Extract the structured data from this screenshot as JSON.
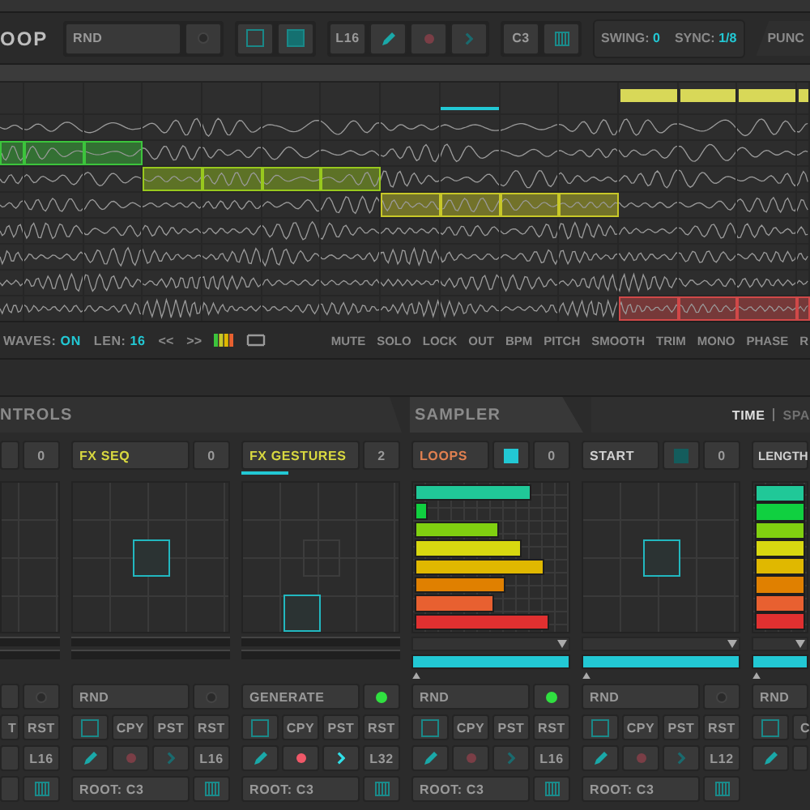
{
  "toolbar": {
    "logo": "OOP",
    "groups": [
      [
        {
          "kind": "field",
          "text": "RND"
        },
        {
          "kind": "led",
          "on": false
        }
      ],
      [
        {
          "kind": "square",
          "on": false
        },
        {
          "kind": "square",
          "on": true
        }
      ],
      [
        {
          "kind": "text",
          "text": "L16"
        },
        {
          "kind": "pen"
        },
        {
          "kind": "record",
          "on": false
        },
        {
          "kind": "next",
          "on": false
        }
      ],
      [
        {
          "kind": "text",
          "text": "C3"
        },
        {
          "kind": "piano"
        }
      ]
    ],
    "stats": [
      {
        "label": "SWING:",
        "value": "0"
      },
      {
        "label": "SYNC:",
        "value": "1/8"
      }
    ],
    "punch": "PUNC"
  },
  "ruler": [
    {
      "looped": false,
      "playing": false
    },
    {
      "looped": false,
      "playing": false
    },
    {
      "looped": false,
      "playing": false
    },
    {
      "looped": false,
      "playing": false
    },
    {
      "looped": false,
      "playing": false
    },
    {
      "looped": false,
      "playing": false
    },
    {
      "looped": false,
      "playing": false
    },
    {
      "looped": false,
      "playing": false
    },
    {
      "looped": false,
      "playing": true
    },
    {
      "looped": false,
      "playing": false
    },
    {
      "looped": false,
      "playing": false
    },
    {
      "looped": true,
      "playing": false
    },
    {
      "looped": true,
      "playing": false
    },
    {
      "looped": true,
      "playing": false
    },
    {
      "looped": true,
      "playing": false
    }
  ],
  "lanes": [
    {
      "cells": [
        false,
        false,
        false,
        false,
        false,
        false,
        false,
        false,
        false,
        false,
        false,
        false,
        false,
        false,
        false
      ]
    },
    {
      "color": "#3cc43c",
      "cells": [
        true,
        true,
        true,
        false,
        false,
        false,
        false,
        false,
        false,
        false,
        false,
        false,
        false,
        false,
        false
      ]
    },
    {
      "color": "#98c81e",
      "cells": [
        false,
        false,
        false,
        true,
        true,
        true,
        true,
        false,
        false,
        false,
        false,
        false,
        false,
        false,
        false
      ]
    },
    {
      "color": "#c8c828",
      "cells": [
        false,
        false,
        false,
        false,
        false,
        false,
        false,
        true,
        true,
        true,
        true,
        false,
        false,
        false,
        false
      ]
    },
    {
      "cells": [
        false,
        false,
        false,
        false,
        false,
        false,
        false,
        false,
        false,
        false,
        false,
        false,
        false,
        false,
        false
      ]
    },
    {
      "cells": [
        false,
        false,
        false,
        false,
        false,
        false,
        false,
        false,
        false,
        false,
        false,
        false,
        false,
        false,
        false
      ]
    },
    {
      "cells": [
        false,
        false,
        false,
        false,
        false,
        false,
        false,
        false,
        false,
        false,
        false,
        false,
        false,
        false,
        false
      ]
    },
    {
      "color": "#d04848",
      "cells": [
        false,
        false,
        false,
        false,
        false,
        false,
        false,
        false,
        false,
        false,
        false,
        true,
        true,
        true,
        true
      ]
    }
  ],
  "lane_toolbar": {
    "options": [
      {
        "label": "WAVES:",
        "value": "ON"
      },
      {
        "label": "LEN:",
        "value": "16"
      }
    ],
    "nav": [
      "<<",
      ">>"
    ],
    "buttons": [
      "MUTE",
      "SOLO",
      "LOCK",
      "OUT",
      "BPM",
      "PITCH",
      "SMOOTH",
      "TRIM",
      "MONO",
      "PHASE",
      "R"
    ]
  },
  "sections": [
    {
      "title": "NTROLS"
    },
    {
      "title": "SAMPLER"
    }
  ],
  "views": [
    {
      "label": "TIME",
      "selected": true
    },
    {
      "label": "SPA",
      "selected": false
    }
  ],
  "modules": [
    {
      "kind": "xy",
      "header": [
        {
          "kind": "cut"
        },
        {
          "kind": "count",
          "text": "0"
        }
      ],
      "handle": false,
      "rows": [
        [
          {
            "kind": "cut"
          },
          {
            "kind": "led",
            "on": false
          }
        ],
        [
          {
            "kind": "cut",
            "text": "T"
          },
          {
            "kind": "text",
            "text": "RST"
          }
        ],
        [
          {
            "kind": "cut"
          },
          {
            "kind": "text",
            "text": "L16"
          }
        ],
        [
          {
            "kind": "cut"
          },
          {
            "kind": "piano"
          }
        ]
      ]
    },
    {
      "kind": "xy",
      "header": [
        {
          "kind": "title",
          "text": "FX SEQ",
          "color": "#d8d840"
        },
        {
          "kind": "count",
          "text": "0"
        }
      ],
      "handle": true,
      "lowered": false,
      "rows": [
        [
          {
            "kind": "field",
            "text": "RND"
          },
          {
            "kind": "led",
            "on": false
          }
        ],
        [
          {
            "kind": "square",
            "on": false
          },
          {
            "kind": "text",
            "text": "CPY"
          },
          {
            "kind": "text",
            "text": "PST"
          },
          {
            "kind": "text",
            "text": "RST"
          }
        ],
        [
          {
            "kind": "pen"
          },
          {
            "kind": "record",
            "on": false
          },
          {
            "kind": "next",
            "on": false
          },
          {
            "kind": "text",
            "text": "L16"
          }
        ],
        [
          {
            "kind": "field",
            "text": "ROOT: C3"
          },
          {
            "kind": "piano"
          }
        ]
      ]
    },
    {
      "kind": "xy",
      "level": 0.3,
      "header": [
        {
          "kind": "title",
          "text": "FX GESTURES",
          "color": "#d8d840"
        },
        {
          "kind": "count",
          "text": "2"
        }
      ],
      "handle": true,
      "lowered": true,
      "ghost": true,
      "rows": [
        [
          {
            "kind": "field",
            "text": "GENERATE"
          },
          {
            "kind": "led",
            "on": true
          }
        ],
        [
          {
            "kind": "square",
            "on": false
          },
          {
            "kind": "text",
            "text": "CPY"
          },
          {
            "kind": "text",
            "text": "PST"
          },
          {
            "kind": "text",
            "text": "RST"
          }
        ],
        [
          {
            "kind": "pen"
          },
          {
            "kind": "record",
            "on": true
          },
          {
            "kind": "next",
            "on": true
          },
          {
            "kind": "text",
            "text": "L32"
          }
        ],
        [
          {
            "kind": "field",
            "text": "ROOT: C3"
          },
          {
            "kind": "piano"
          }
        ]
      ]
    },
    {
      "kind": "bars",
      "header": [
        {
          "kind": "title",
          "text": "LOOPS",
          "color": "#e08050"
        },
        {
          "kind": "indicator",
          "on": true
        },
        {
          "kind": "count",
          "text": "0"
        }
      ],
      "bars": [
        {
          "level": 0.77,
          "color": "#20c898"
        },
        {
          "level": 0.09,
          "color": "#10d040"
        },
        {
          "level": 0.55,
          "color": "#80d010"
        },
        {
          "level": 0.7,
          "color": "#d8d810"
        },
        {
          "level": 0.85,
          "color": "#e0b800"
        },
        {
          "level": 0.6,
          "color": "#e08000"
        },
        {
          "level": 0.52,
          "color": "#e86030"
        },
        {
          "level": 0.88,
          "color": "#e03030"
        }
      ],
      "range": {
        "level": 1
      },
      "rows": [
        [
          {
            "kind": "field",
            "text": "RND"
          },
          {
            "kind": "led",
            "on": true
          }
        ],
        [
          {
            "kind": "square",
            "on": false
          },
          {
            "kind": "text",
            "text": "CPY"
          },
          {
            "kind": "text",
            "text": "PST"
          },
          {
            "kind": "text",
            "text": "RST"
          }
        ],
        [
          {
            "kind": "pen"
          },
          {
            "kind": "record",
            "on": false
          },
          {
            "kind": "next",
            "on": false
          },
          {
            "kind": "text",
            "text": "L16"
          }
        ],
        [
          {
            "kind": "field",
            "text": "ROOT: C3"
          },
          {
            "kind": "piano"
          }
        ]
      ]
    },
    {
      "kind": "xy",
      "header": [
        {
          "kind": "title",
          "text": "START",
          "color": "#d0d0d0"
        },
        {
          "kind": "indicator",
          "on": false
        },
        {
          "kind": "count",
          "text": "0"
        }
      ],
      "handle": true,
      "lowered": false,
      "range": {
        "level": 1
      },
      "rows": [
        [
          {
            "kind": "field",
            "text": "RND"
          },
          {
            "kind": "led",
            "on": false
          }
        ],
        [
          {
            "kind": "square",
            "on": false
          },
          {
            "kind": "text",
            "text": "CPY"
          },
          {
            "kind": "text",
            "text": "PST"
          },
          {
            "kind": "text",
            "text": "RST"
          }
        ],
        [
          {
            "kind": "pen"
          },
          {
            "kind": "record",
            "on": false
          },
          {
            "kind": "next",
            "on": false
          },
          {
            "kind": "text",
            "text": "L12"
          }
        ],
        [
          {
            "kind": "field",
            "text": "ROOT: C3"
          },
          {
            "kind": "piano"
          }
        ]
      ]
    },
    {
      "kind": "bars",
      "header": [
        {
          "kind": "title",
          "text": "LENGTH",
          "color": "#d0d0d0"
        }
      ],
      "bars": [
        {
          "color": "#20c898"
        },
        {
          "color": "#10d040"
        },
        {
          "color": "#80d010"
        },
        {
          "color": "#d8d810"
        },
        {
          "color": "#e0b800"
        },
        {
          "color": "#e08000"
        },
        {
          "color": "#e86030"
        },
        {
          "color": "#e03030"
        }
      ],
      "range": {
        "level": 1
      },
      "rows": [
        [
          {
            "kind": "field",
            "text": "RND"
          }
        ],
        [
          {
            "kind": "square",
            "on": false
          },
          {
            "kind": "cut",
            "text": "C"
          }
        ],
        [
          {
            "kind": "pen"
          },
          {
            "kind": "cut"
          }
        ]
      ]
    }
  ]
}
